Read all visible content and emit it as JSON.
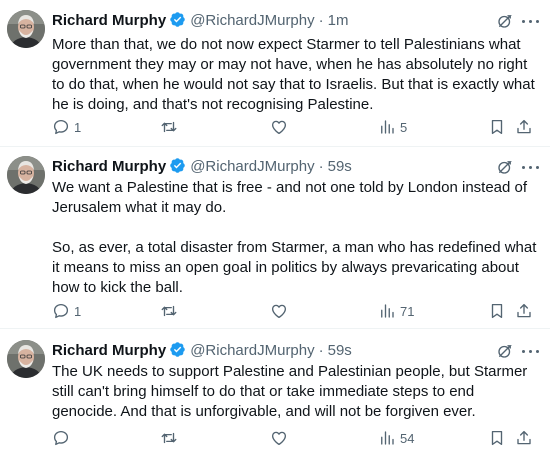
{
  "tweets": [
    {
      "name": "Richard Murphy",
      "handle": "@RichardJMurphy",
      "time": "1m",
      "text": "More than that, we do not now expect Starmer to tell Palestinians what government they may or may not have, when he has absolutely no right to do that, when he would not say that to Israelis. But that is exactly what he is doing, and that's not recognising Palestine.",
      "replies": "1",
      "reposts": "",
      "likes": "",
      "views": "5"
    },
    {
      "name": "Richard Murphy",
      "handle": "@RichardJMurphy",
      "time": "59s",
      "text": "We want a Palestine that is free - and not one told by London instead of Jerusalem what it may do.\n\nSo, as ever, a total disaster from Starmer, a man who has redefined what it means to miss an open goal in politics by always prevaricating about how to kick the ball.",
      "replies": "1",
      "reposts": "",
      "likes": "",
      "views": "71"
    },
    {
      "name": "Richard Murphy",
      "handle": "@RichardJMurphy",
      "time": "59s",
      "text": "The UK needs to support Palestine and Palestinian people, but Starmer still can't bring himself to do that or take immediate steps to end genocide. And that is unforgivable, and will not be forgiven ever.",
      "replies": "",
      "reposts": "",
      "likes": "",
      "views": "54"
    }
  ],
  "separator": "·",
  "icons": {
    "verified": "verified-badge-icon",
    "grok": "grok-icon",
    "more": "more-icon",
    "reply": "reply-icon",
    "repost": "repost-icon",
    "like": "like-icon",
    "views": "views-icon",
    "bookmark": "bookmark-icon",
    "share": "share-icon"
  },
  "colors": {
    "verified": "#1d9bf0",
    "text": "#0f1419",
    "muted": "#536471",
    "divider": "#eff3f4"
  }
}
